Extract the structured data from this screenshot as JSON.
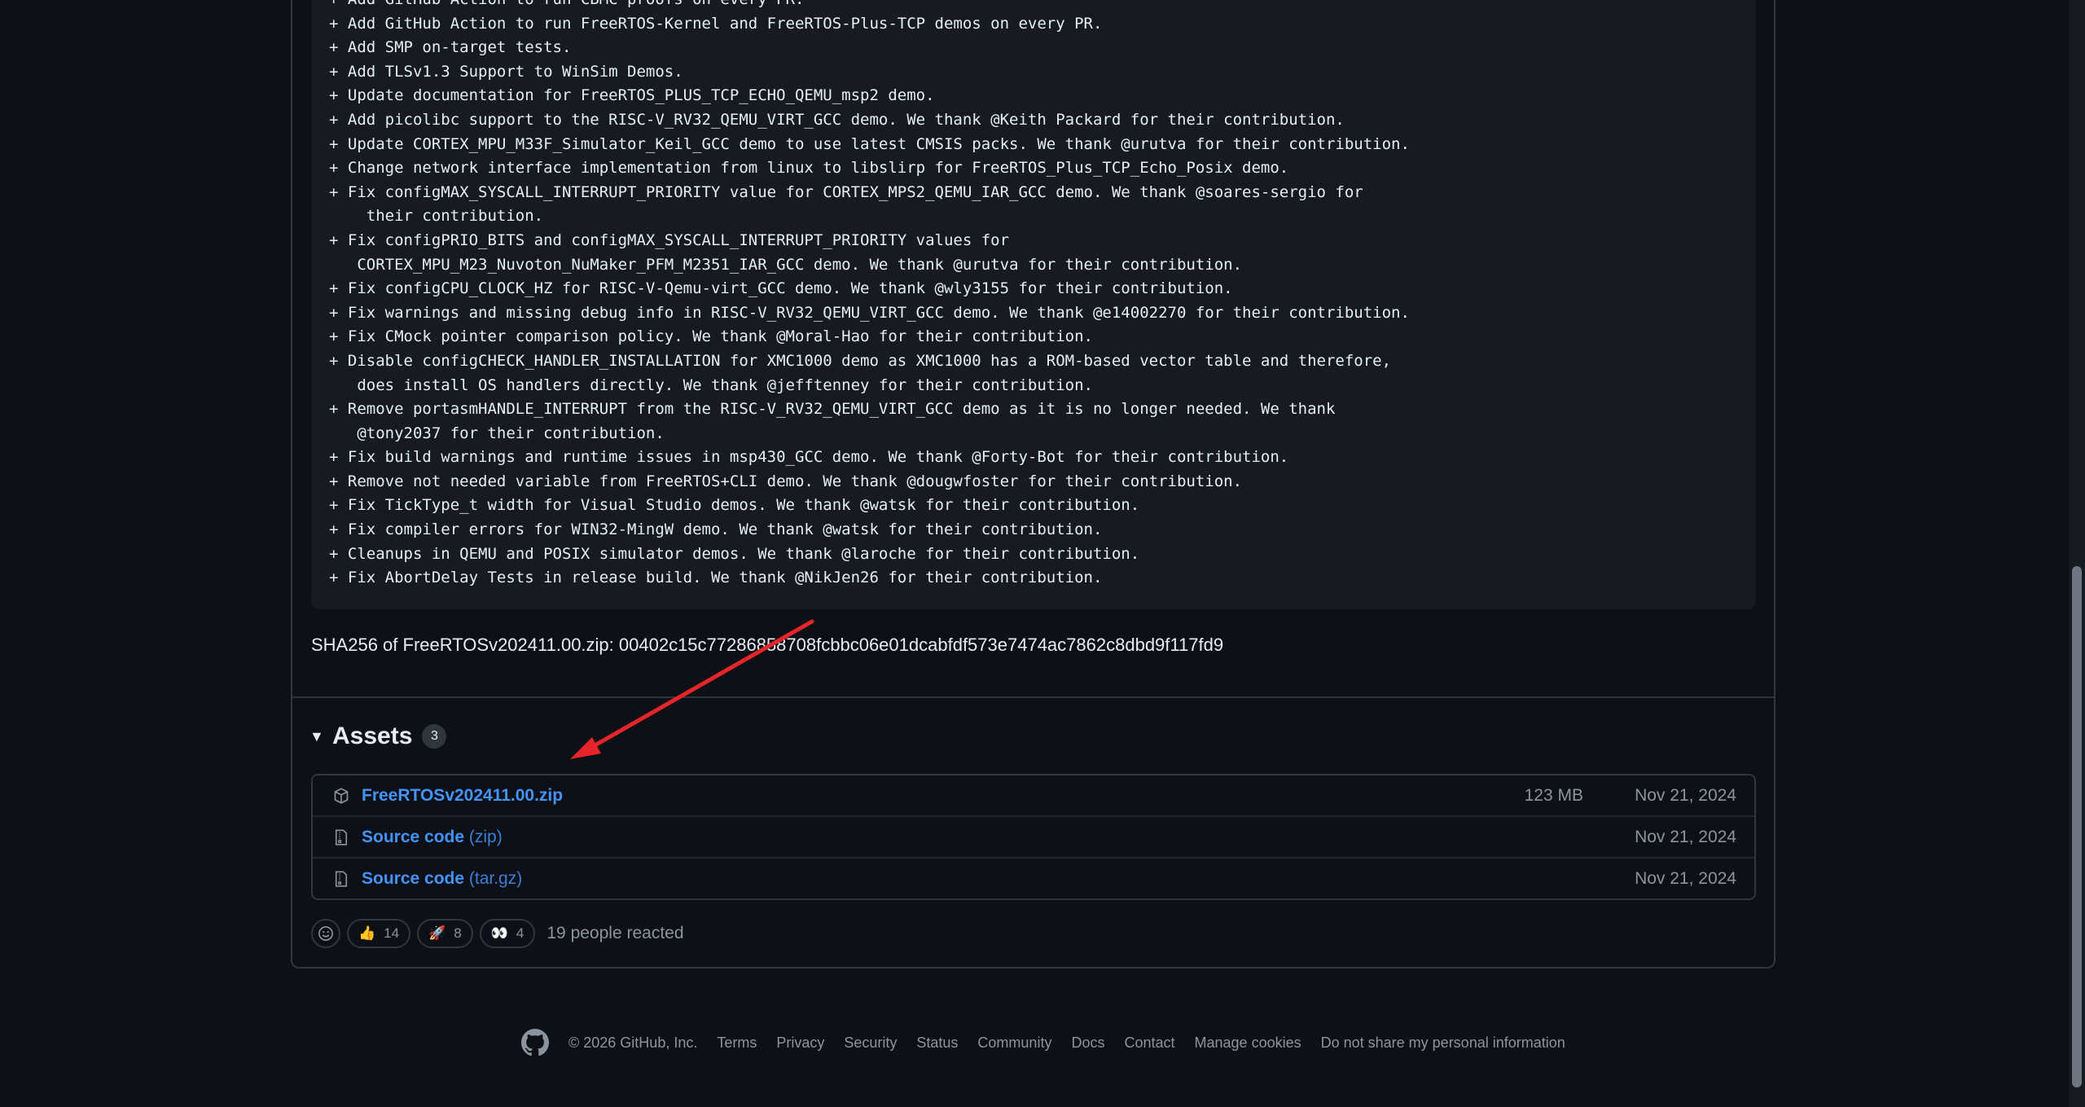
{
  "release_notes": {
    "lines": [
      "+ Add GitHub Action to run CBMC proofs on every PR.",
      "+ Add GitHub Action to run FreeRTOS-Kernel and FreeRTOS-Plus-TCP demos on every PR.",
      "+ Add SMP on-target tests.",
      "+ Add TLSv1.3 Support to WinSim Demos.",
      "+ Update documentation for FreeRTOS_PLUS_TCP_ECHO_QEMU_msp2 demo.",
      "+ Add picolibc support to the RISC-V_RV32_QEMU_VIRT_GCC demo. We thank @Keith Packard for their contribution.",
      "+ Update CORTEX_MPU_M33F_Simulator_Keil_GCC demo to use latest CMSIS packs. We thank @urutva for their contribution.",
      "+ Change network interface implementation from linux to libslirp for FreeRTOS_Plus_TCP_Echo_Posix demo.",
      "+ Fix configMAX_SYSCALL_INTERRUPT_PRIORITY value for CORTEX_MPS2_QEMU_IAR_GCC demo. We thank @soares-sergio for",
      "    their contribution.",
      "+ Fix configPRIO_BITS and configMAX_SYSCALL_INTERRUPT_PRIORITY values for",
      "   CORTEX_MPU_M23_Nuvoton_NuMaker_PFM_M2351_IAR_GCC demo. We thank @urutva for their contribution.",
      "+ Fix configCPU_CLOCK_HZ for RISC-V-Qemu-virt_GCC demo. We thank @wly3155 for their contribution.",
      "+ Fix warnings and missing debug info in RISC-V_RV32_QEMU_VIRT_GCC demo. We thank @e14002270 for their contribution.",
      "+ Fix CMock pointer comparison policy. We thank @Moral-Hao for their contribution.",
      "+ Disable configCHECK_HANDLER_INSTALLATION for XMC1000 demo as XMC1000 has a ROM-based vector table and therefore,",
      "   does install OS handlers directly. We thank @jefftenney for their contribution.",
      "+ Remove portasmHANDLE_INTERRUPT from the RISC-V_RV32_QEMU_VIRT_GCC demo as it is no longer needed. We thank",
      "   @tony2037 for their contribution.",
      "+ Fix build warnings and runtime issues in msp430_GCC demo. We thank @Forty-Bot for their contribution.",
      "+ Remove not needed variable from FreeRTOS+CLI demo. We thank @dougwfoster for their contribution.",
      "+ Fix TickType_t width for Visual Studio demos. We thank @watsk for their contribution.",
      "+ Fix compiler errors for WIN32-MingW demo. We thank @watsk for their contribution.",
      "+ Cleanups in QEMU and POSIX simulator demos. We thank @laroche for their contribution.",
      "+ Fix AbortDelay Tests in release build. We thank @NikJen26 for their contribution."
    ]
  },
  "sha": "SHA256 of FreeRTOSv202411.00.zip: 00402c15c77286858708fcbbc06e01dcabfdf573e7474ac7862c8dbd9f117fd9",
  "assets": {
    "title": "Assets",
    "count": "3",
    "items": [
      {
        "name": "FreeRTOSv202411.00.zip",
        "suffix": "",
        "size": "123 MB",
        "date": "Nov 21, 2024",
        "icon": "package-icon"
      },
      {
        "name": "Source code",
        "suffix": " (zip)",
        "size": "",
        "date": "Nov 21, 2024",
        "icon": "file-zip-icon"
      },
      {
        "name": "Source code",
        "suffix": " (tar.gz)",
        "size": "",
        "date": "Nov 21, 2024",
        "icon": "file-zip-icon"
      }
    ]
  },
  "reactions": {
    "items": [
      {
        "emoji": "👍",
        "count": "14",
        "name": "thumbs-up"
      },
      {
        "emoji": "🚀",
        "count": "8",
        "name": "rocket"
      },
      {
        "emoji": "👀",
        "count": "4",
        "name": "eyes"
      }
    ],
    "summary": "19 people reacted"
  },
  "footer": {
    "copyright": "© 2026 GitHub, Inc.",
    "links": [
      "Terms",
      "Privacy",
      "Security",
      "Status",
      "Community",
      "Docs",
      "Contact",
      "Manage cookies",
      "Do not share my personal information"
    ]
  },
  "colors": {
    "background": "#0d1117",
    "link": "#4493f8",
    "annotation_arrow": "#e5252a"
  }
}
